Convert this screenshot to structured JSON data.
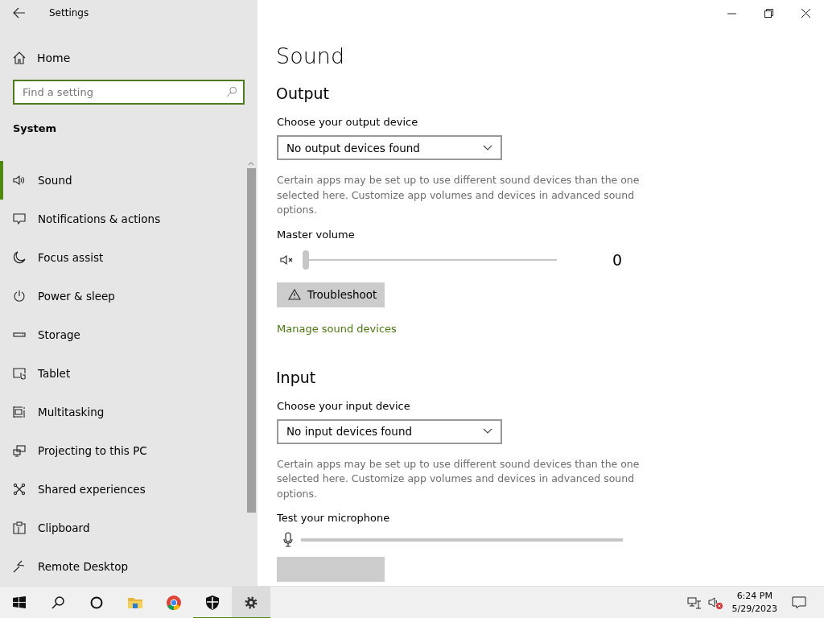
{
  "window": {
    "title": "Settings"
  },
  "sidebar": {
    "home": "Home",
    "search": {
      "placeholder": "Find a setting"
    },
    "section": "System",
    "items": [
      {
        "label": "Sound",
        "kind": "sound",
        "selected": true
      },
      {
        "label": "Notifications & actions",
        "kind": "notifications",
        "selected": false
      },
      {
        "label": "Focus assist",
        "kind": "moon",
        "selected": false
      },
      {
        "label": "Power & sleep",
        "kind": "power",
        "selected": false
      },
      {
        "label": "Storage",
        "kind": "storage",
        "selected": false
      },
      {
        "label": "Tablet",
        "kind": "tablet",
        "selected": false
      },
      {
        "label": "Multitasking",
        "kind": "multitasking",
        "selected": false
      },
      {
        "label": "Projecting to this PC",
        "kind": "projecting",
        "selected": false
      },
      {
        "label": "Shared experiences",
        "kind": "shared",
        "selected": false
      },
      {
        "label": "Clipboard",
        "kind": "clipboard",
        "selected": false
      },
      {
        "label": "Remote Desktop",
        "kind": "remote",
        "selected": false
      }
    ]
  },
  "page": {
    "title": "Sound",
    "output": {
      "heading": "Output",
      "device_label": "Choose your output device",
      "device": "No output devices found",
      "note": "Certain apps may be set up to use different sound devices than the one selected here. Customize app volumes and devices in advanced sound options.",
      "volume_label": "Master volume",
      "volume": {
        "muted": true,
        "level": 0,
        "reading": "0"
      },
      "troubleshoot": "Troubleshoot",
      "link": "Manage sound devices"
    },
    "input": {
      "heading": "Input",
      "device_label": "Choose your input device",
      "device": "No input devices found",
      "note": "Certain apps may be set up to use different sound devices than the one selected here. Customize app volumes and devices in advanced sound options.",
      "mic_label": "Test your microphone",
      "mic": {
        "level": 0
      }
    }
  },
  "taskbar": {
    "apps": [
      {
        "kind": "start",
        "running": false,
        "selected": false
      },
      {
        "kind": "search",
        "running": false,
        "selected": false
      },
      {
        "kind": "cortana",
        "running": false,
        "selected": false
      },
      {
        "kind": "explorer",
        "running": false,
        "selected": false
      },
      {
        "kind": "chrome",
        "running": false,
        "selected": false
      },
      {
        "kind": "security",
        "running": true,
        "selected": false
      },
      {
        "kind": "settings",
        "running": true,
        "selected": true
      }
    ],
    "clock": {
      "time": "6:24 PM",
      "date": "5/29/2023"
    }
  }
}
